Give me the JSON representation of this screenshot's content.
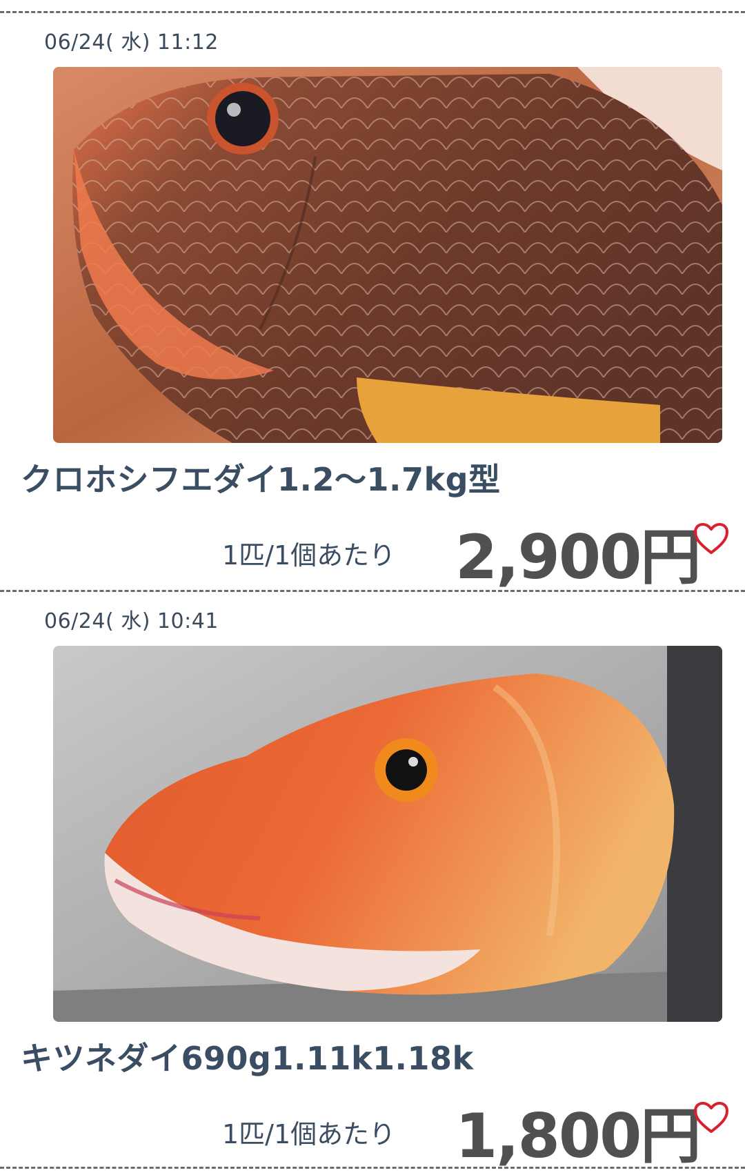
{
  "listings": [
    {
      "timestamp": "06/24( 水) 11:12",
      "photo_subject": "fish-photo",
      "title": "クロホシフエダイ1.2〜1.7kg型",
      "unit": "1匹/1個あたり",
      "price": "2,900円",
      "favorite_icon": "heart-icon"
    },
    {
      "timestamp": "06/24( 水) 10:41",
      "photo_subject": "fish-photo",
      "title": "キツネダイ690g1.11k1.18k",
      "unit": "1匹/1個あたり",
      "price": "1,800円",
      "favorite_icon": "heart-icon"
    }
  ],
  "colors": {
    "title": "#3b4d63",
    "price": "#505050",
    "heart": "#d8202f",
    "divider": "#6b6b6b"
  }
}
